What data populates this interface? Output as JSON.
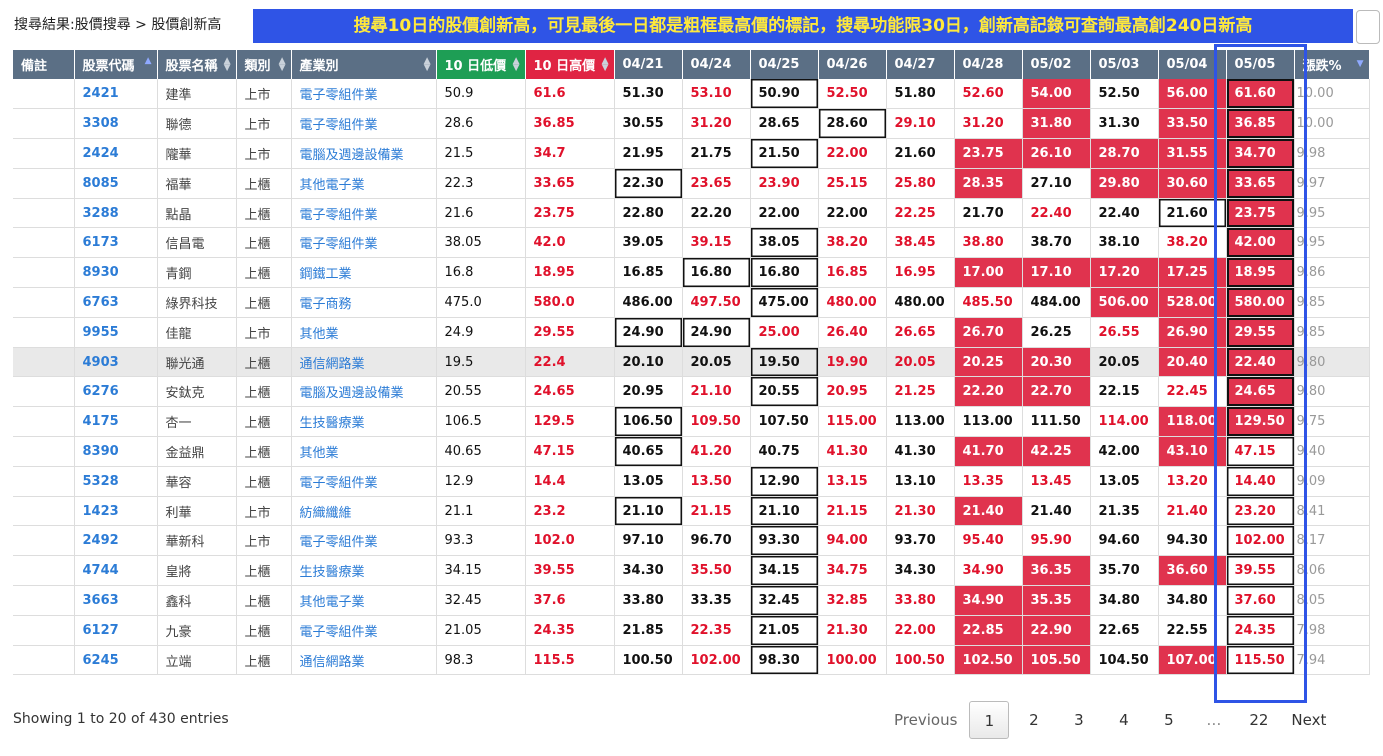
{
  "breadcrumb": "搜尋結果:股價搜尋 > 股價創新高",
  "banner": "搜尋10日的股價創新高，可見最後一日都是粗框最高價的標記，搜尋功能限30日，創新高記錄可查詢最高創240日新高",
  "columns": [
    "備註",
    "股票代碼",
    "股票名稱",
    "類別",
    "產業別",
    "10 日低價",
    "10 日高價",
    "04/21",
    "04/24",
    "04/25",
    "04/26",
    "04/27",
    "04/28",
    "05/02",
    "05/03",
    "05/04",
    "05/05",
    "漲跌%"
  ],
  "rows": [
    {
      "code": "2421",
      "name": "建準",
      "cat": "上市",
      "ind": "電子零組件業",
      "low": "50.9",
      "high": "61.6",
      "p": [
        "51.30",
        "53.10",
        "50.90",
        "52.50",
        "51.80",
        "52.60",
        "54.00",
        "52.50",
        "56.00",
        "61.60"
      ],
      "chg": "10.00"
    },
    {
      "code": "3308",
      "name": "聯德",
      "cat": "上市",
      "ind": "電子零組件業",
      "low": "28.6",
      "high": "36.85",
      "p": [
        "30.55",
        "31.20",
        "28.65",
        "28.60",
        "29.10",
        "31.20",
        "31.80",
        "31.30",
        "33.50",
        "36.85"
      ],
      "chg": "10.00"
    },
    {
      "code": "2424",
      "name": "隴華",
      "cat": "上市",
      "ind": "電腦及週邊設備業",
      "low": "21.5",
      "high": "34.7",
      "p": [
        "21.95",
        "21.75",
        "21.50",
        "22.00",
        "21.60",
        "23.75",
        "26.10",
        "28.70",
        "31.55",
        "34.70"
      ],
      "chg": "9.98"
    },
    {
      "code": "8085",
      "name": "福華",
      "cat": "上櫃",
      "ind": "其他電子業",
      "low": "22.3",
      "high": "33.65",
      "p": [
        "22.30",
        "23.65",
        "23.90",
        "25.15",
        "25.80",
        "28.35",
        "27.10",
        "29.80",
        "30.60",
        "33.65"
      ],
      "chg": "9.97"
    },
    {
      "code": "3288",
      "name": "點晶",
      "cat": "上櫃",
      "ind": "電子零組件業",
      "low": "21.6",
      "high": "23.75",
      "p": [
        "22.80",
        "22.20",
        "22.00",
        "22.00",
        "22.25",
        "21.70",
        "22.40",
        "22.40",
        "21.60",
        "23.75"
      ],
      "chg": "9.95"
    },
    {
      "code": "6173",
      "name": "信昌電",
      "cat": "上櫃",
      "ind": "電子零組件業",
      "low": "38.05",
      "high": "42.0",
      "p": [
        "39.05",
        "39.15",
        "38.05",
        "38.20",
        "38.45",
        "38.80",
        "38.70",
        "38.10",
        "38.20",
        "42.00"
      ],
      "chg": "9.95"
    },
    {
      "code": "8930",
      "name": "青鋼",
      "cat": "上櫃",
      "ind": "鋼鐵工業",
      "low": "16.8",
      "high": "18.95",
      "p": [
        "16.85",
        "16.80",
        "16.80",
        "16.85",
        "16.95",
        "17.00",
        "17.10",
        "17.20",
        "17.25",
        "18.95"
      ],
      "chg": "9.86"
    },
    {
      "code": "6763",
      "name": "綠界科技",
      "cat": "上櫃",
      "ind": "電子商務",
      "low": "475.0",
      "high": "580.0",
      "p": [
        "486.00",
        "497.50",
        "475.00",
        "480.00",
        "480.00",
        "485.50",
        "484.00",
        "506.00",
        "528.00",
        "580.00"
      ],
      "chg": "9.85"
    },
    {
      "code": "9955",
      "name": "佳龍",
      "cat": "上市",
      "ind": "其他業",
      "low": "24.9",
      "high": "29.55",
      "p": [
        "24.90",
        "24.90",
        "25.00",
        "26.40",
        "26.65",
        "26.70",
        "26.25",
        "26.55",
        "26.90",
        "29.55"
      ],
      "chg": "9.85"
    },
    {
      "code": "4903",
      "name": "聯光通",
      "cat": "上櫃",
      "ind": "通信網路業",
      "low": "19.5",
      "high": "22.4",
      "p": [
        "20.10",
        "20.05",
        "19.50",
        "19.90",
        "20.05",
        "20.25",
        "20.30",
        "20.05",
        "20.40",
        "22.40"
      ],
      "chg": "9.80"
    },
    {
      "code": "6276",
      "name": "安鈦克",
      "cat": "上櫃",
      "ind": "電腦及週邊設備業",
      "low": "20.55",
      "high": "24.65",
      "p": [
        "20.95",
        "21.10",
        "20.55",
        "20.95",
        "21.25",
        "22.20",
        "22.70",
        "22.15",
        "22.45",
        "24.65"
      ],
      "chg": "9.80"
    },
    {
      "code": "4175",
      "name": "杏一",
      "cat": "上櫃",
      "ind": "生技醫療業",
      "low": "106.5",
      "high": "129.5",
      "p": [
        "106.50",
        "109.50",
        "107.50",
        "115.00",
        "113.00",
        "113.00",
        "111.50",
        "114.00",
        "118.00",
        "129.50"
      ],
      "chg": "9.75"
    },
    {
      "code": "8390",
      "name": "金益鼎",
      "cat": "上櫃",
      "ind": "其他業",
      "low": "40.65",
      "high": "47.15",
      "p": [
        "40.65",
        "41.20",
        "40.75",
        "41.30",
        "41.30",
        "41.70",
        "42.25",
        "42.00",
        "43.10",
        "47.15"
      ],
      "chg": "9.40"
    },
    {
      "code": "5328",
      "name": "華容",
      "cat": "上櫃",
      "ind": "電子零組件業",
      "low": "12.9",
      "high": "14.4",
      "p": [
        "13.05",
        "13.50",
        "12.90",
        "13.15",
        "13.10",
        "13.35",
        "13.45",
        "13.05",
        "13.20",
        "14.40"
      ],
      "chg": "9.09"
    },
    {
      "code": "1423",
      "name": "利華",
      "cat": "上市",
      "ind": "紡織纖維",
      "low": "21.1",
      "high": "23.2",
      "p": [
        "21.10",
        "21.15",
        "21.10",
        "21.15",
        "21.30",
        "21.40",
        "21.40",
        "21.35",
        "21.40",
        "23.20"
      ],
      "chg": "8.41"
    },
    {
      "code": "2492",
      "name": "華新科",
      "cat": "上市",
      "ind": "電子零組件業",
      "low": "93.3",
      "high": "102.0",
      "p": [
        "97.10",
        "96.70",
        "93.30",
        "94.00",
        "93.70",
        "95.40",
        "95.90",
        "94.60",
        "94.30",
        "102.00"
      ],
      "chg": "8.17"
    },
    {
      "code": "4744",
      "name": "皇將",
      "cat": "上櫃",
      "ind": "生技醫療業",
      "low": "34.15",
      "high": "39.55",
      "p": [
        "34.30",
        "35.50",
        "34.15",
        "34.75",
        "34.30",
        "34.90",
        "36.35",
        "35.70",
        "36.60",
        "39.55"
      ],
      "chg": "8.06"
    },
    {
      "code": "3663",
      "name": "鑫科",
      "cat": "上櫃",
      "ind": "其他電子業",
      "low": "32.45",
      "high": "37.6",
      "p": [
        "33.80",
        "33.35",
        "32.45",
        "32.85",
        "33.80",
        "34.90",
        "35.35",
        "34.80",
        "34.80",
        "37.60"
      ],
      "chg": "8.05"
    },
    {
      "code": "6127",
      "name": "九豪",
      "cat": "上櫃",
      "ind": "電子零組件業",
      "low": "21.05",
      "high": "24.35",
      "p": [
        "21.85",
        "22.35",
        "21.05",
        "21.30",
        "22.00",
        "22.85",
        "22.90",
        "22.65",
        "22.55",
        "24.35"
      ],
      "chg": "7.98"
    },
    {
      "code": "6245",
      "name": "立端",
      "cat": "上櫃",
      "ind": "通信網路業",
      "low": "98.3",
      "high": "115.5",
      "p": [
        "100.50",
        "102.00",
        "98.30",
        "100.00",
        "100.50",
        "102.50",
        "105.50",
        "104.50",
        "107.00",
        "115.50"
      ],
      "chg": "7.94"
    }
  ],
  "footer": {
    "info": "Showing 1 to 20 of 430 entries",
    "prev": "Previous",
    "pages": [
      "1",
      "2",
      "3",
      "4",
      "5"
    ],
    "ellipsis": "…",
    "last": "22",
    "next": "Next"
  },
  "colors": {
    "header": "#5b6f85",
    "low_header": "#1e9e55",
    "high_header": "#e02443",
    "price_up": "#e0112b",
    "new_high_fill": "#e0334e",
    "code_link": "#2c7cd6",
    "banner_bg": "#2f54e6",
    "banner_text": "#ffe93b"
  }
}
